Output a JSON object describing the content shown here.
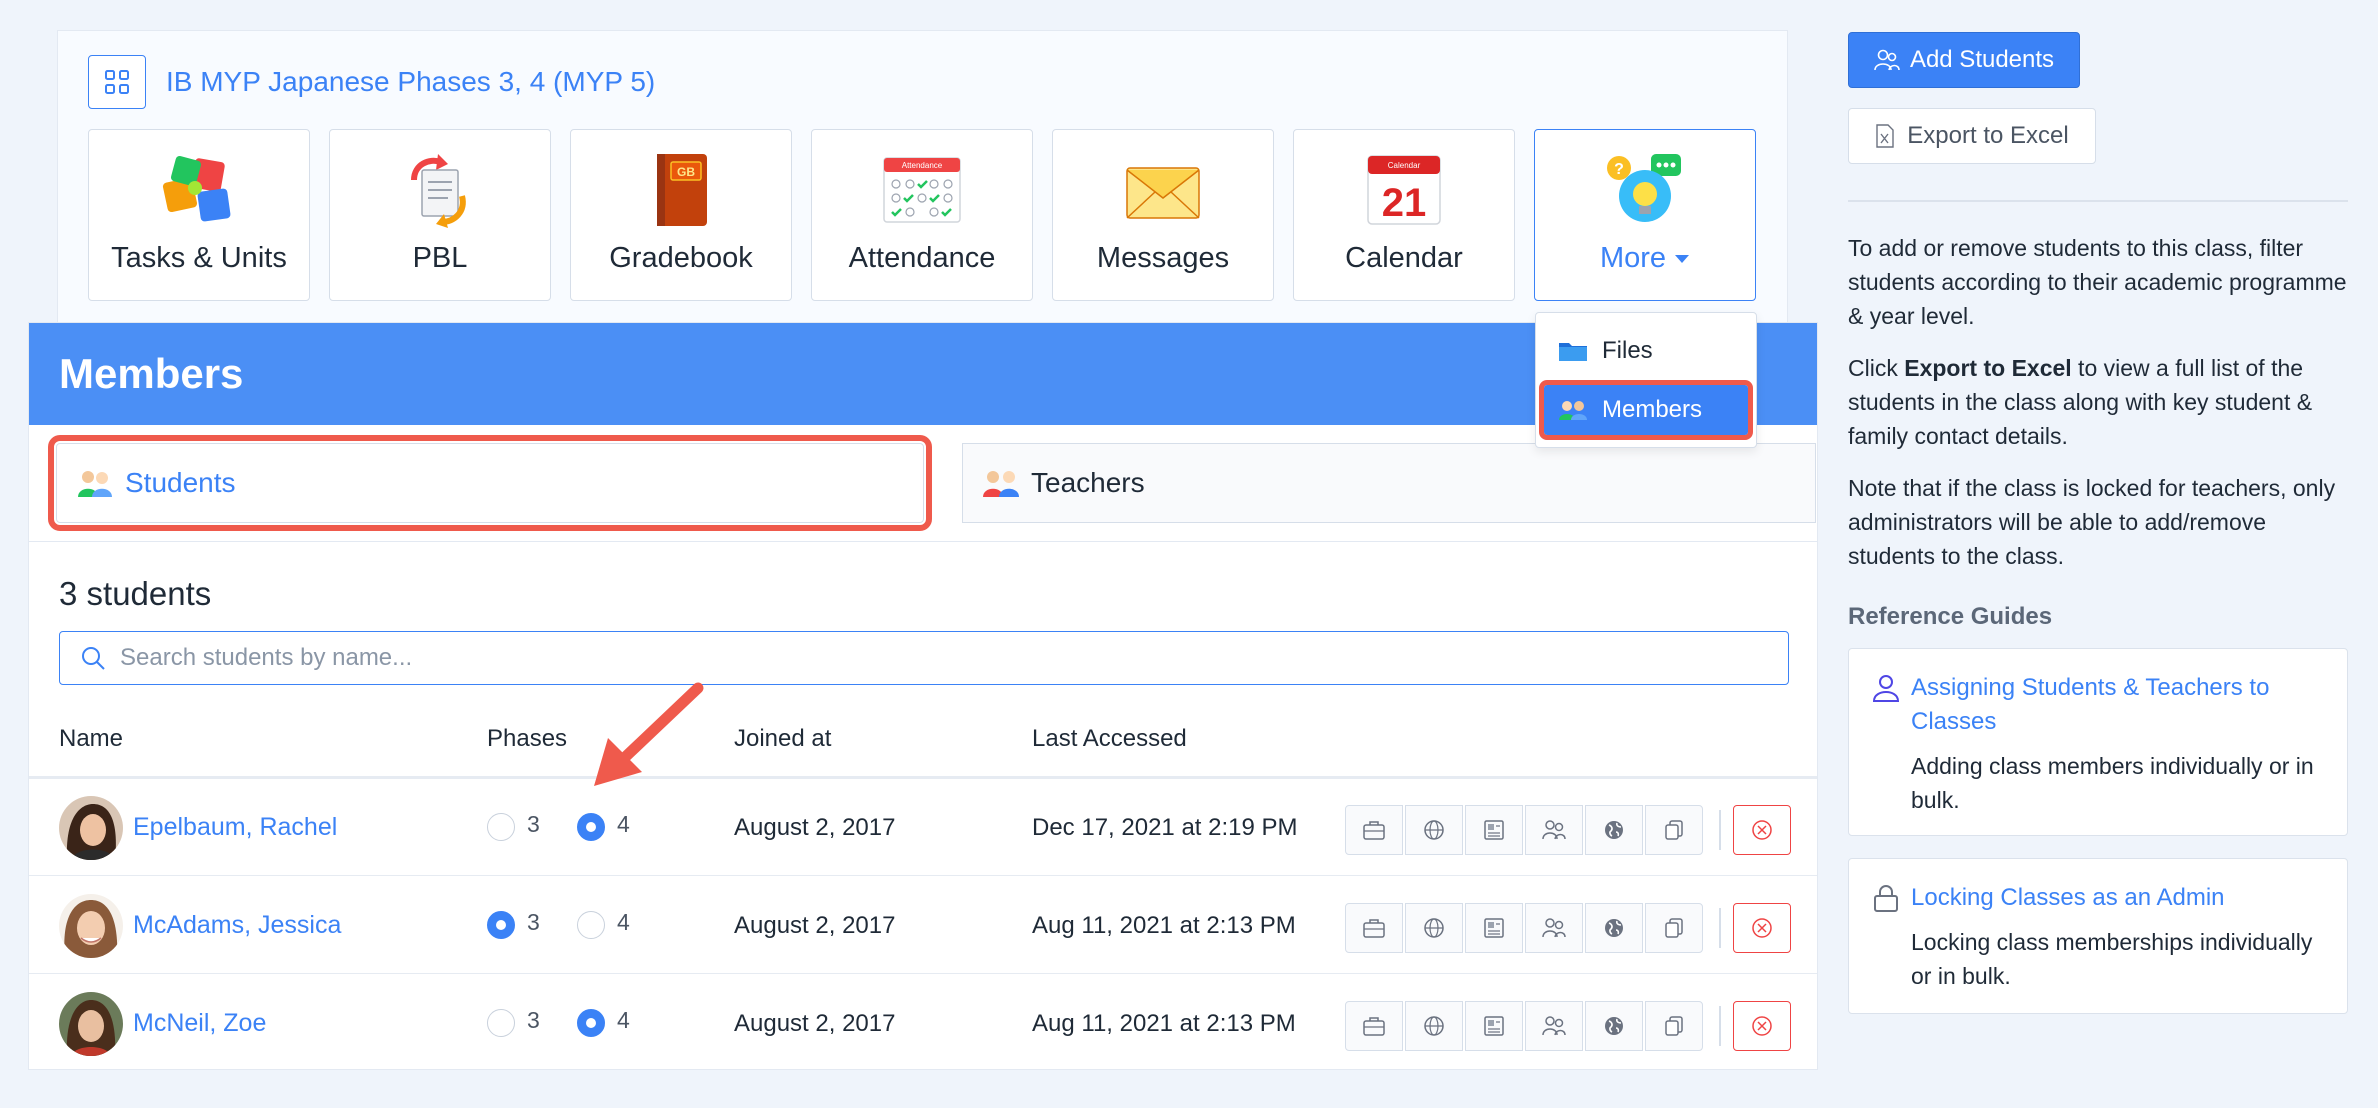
{
  "class_header": {
    "title": "IB MYP Japanese Phases 3, 4 (MYP 5)",
    "tiles": [
      {
        "label": "Tasks & Units",
        "icon": "puzzle-icon"
      },
      {
        "label": "PBL",
        "icon": "documents-icon"
      },
      {
        "label": "Gradebook",
        "icon": "gradebook-icon"
      },
      {
        "label": "Attendance",
        "icon": "attendance-icon"
      },
      {
        "label": "Messages",
        "icon": "envelope-icon"
      },
      {
        "label": "Calendar",
        "icon": "calendar-icon"
      },
      {
        "label": "More",
        "icon": "lightbulb-icon"
      }
    ],
    "attendance_icon_text": "Attendance",
    "calendar_icon_header": "Calendar",
    "calendar_icon_day": "21",
    "gradebook_icon_text": "GB"
  },
  "more_menu": {
    "items": [
      {
        "label": "Files",
        "icon": "folder-icon"
      },
      {
        "label": "Members",
        "icon": "members-icon",
        "selected": true
      }
    ]
  },
  "members": {
    "title": "Members",
    "tabs": [
      {
        "label": "Students",
        "active": true
      },
      {
        "label": "Teachers",
        "active": false
      }
    ],
    "count_label": "3 students",
    "search_placeholder": "Search students by name...",
    "columns": {
      "name": "Name",
      "phases": "Phases",
      "joined": "Joined at",
      "accessed": "Last Accessed"
    },
    "phase_options": [
      "3",
      "4"
    ],
    "students": [
      {
        "name": "Epelbaum, Rachel",
        "phase": "4",
        "joined": "August 2, 2017",
        "accessed": "Dec 17, 2021 at 2:19 PM"
      },
      {
        "name": "McAdams, Jessica",
        "phase": "3",
        "joined": "August 2, 2017",
        "accessed": "Aug 11, 2021 at 2:13 PM"
      },
      {
        "name": "McNeil, Zoe",
        "phase": "4",
        "joined": "August 2, 2017",
        "accessed": "Aug 11, 2021 at 2:13 PM"
      }
    ],
    "row_actions": [
      "briefcase-icon",
      "globe-icon",
      "id-card-icon",
      "family-icon",
      "world-icon",
      "copy-icon",
      "remove-icon"
    ]
  },
  "sidebar": {
    "add_students": "Add Students",
    "export_excel": "Export to Excel",
    "help_1": "To add or remove students to this class, filter students according to their academic programme & year level.",
    "help_2_prefix": "Click ",
    "help_2_bold": "Export to Excel",
    "help_2_suffix": " to view a full list of the students in the class along with key student & family contact details.",
    "help_3": "Note that if the class is locked for teachers, only administrators will be able to add/remove students to the class.",
    "reference_title": "Reference Guides",
    "guides": [
      {
        "title": "Assigning Students & Teachers to Classes",
        "desc": "Adding class members individually or in bulk.",
        "icon": "person-icon"
      },
      {
        "title": "Locking Classes as an Admin",
        "desc": "Locking class memberships individually or in bulk.",
        "icon": "lock-icon"
      }
    ]
  },
  "colors": {
    "accent": "#3b82f6",
    "header": "#4b8ff5",
    "highlight": "#ef5a4c",
    "danger": "#ef4444"
  }
}
